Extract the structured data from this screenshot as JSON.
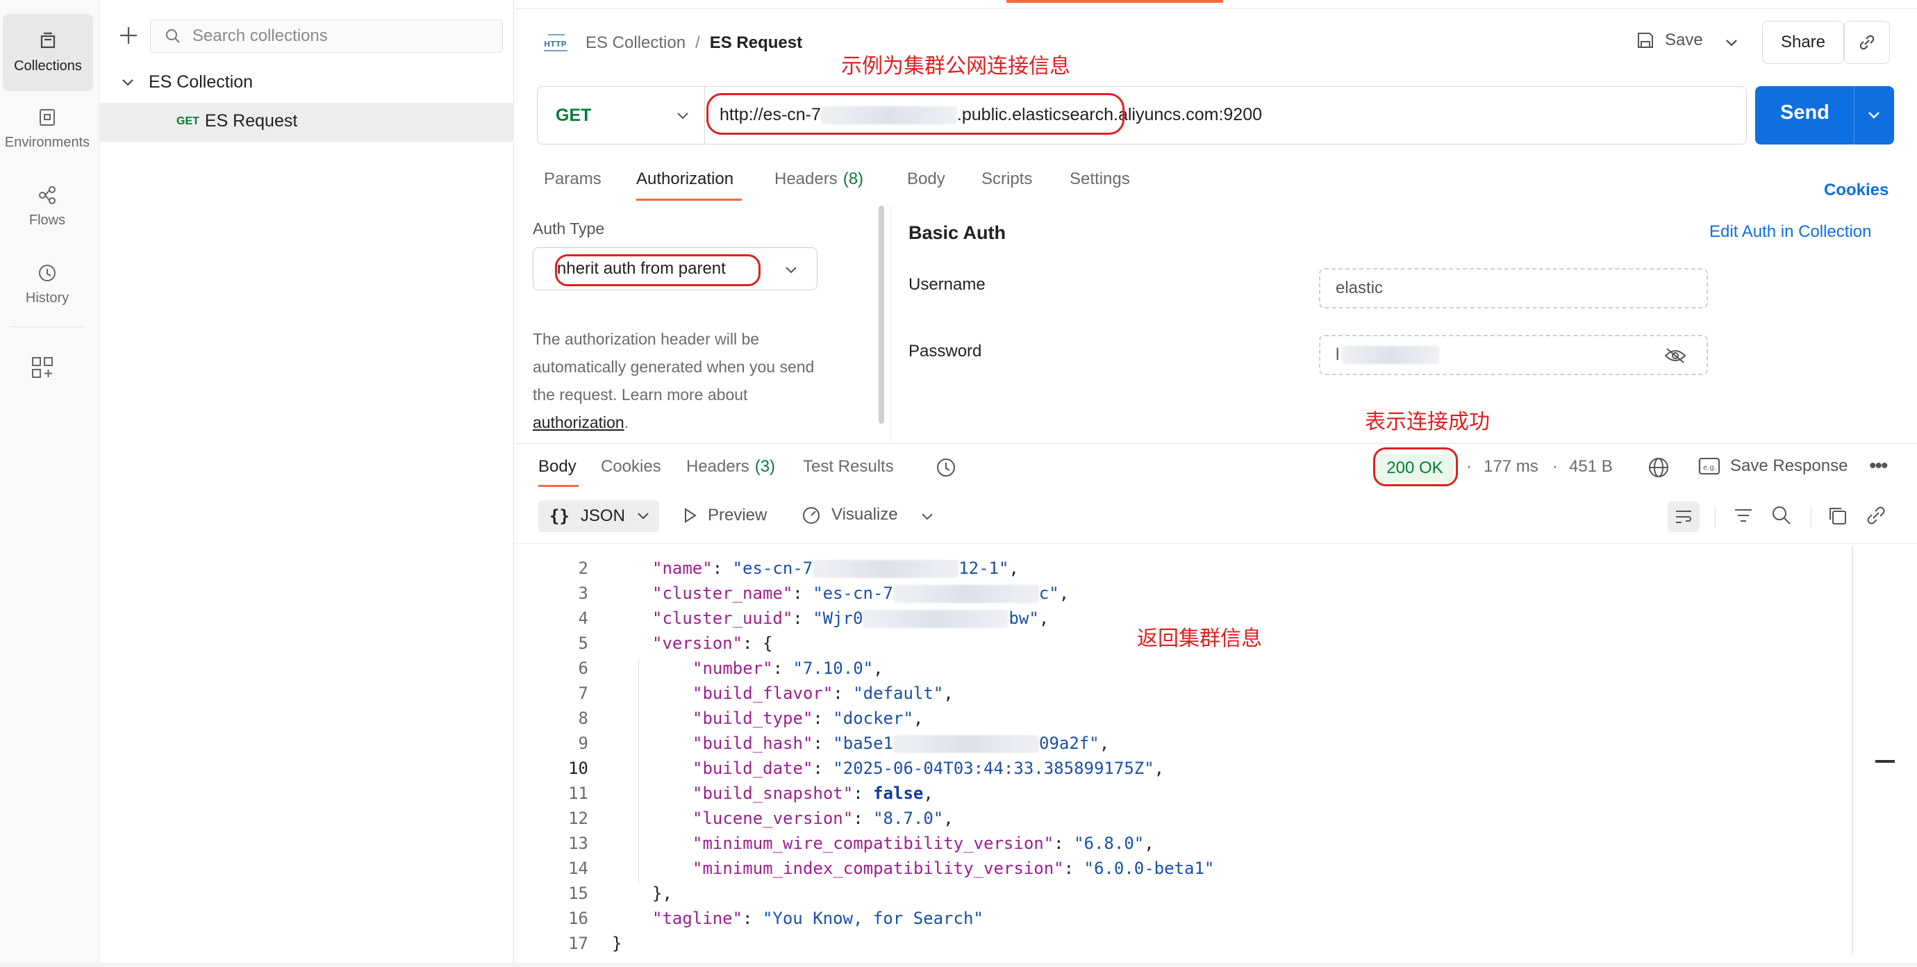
{
  "rail": {
    "items": [
      {
        "label": "Collections",
        "icon": "collections-icon"
      },
      {
        "label": "Environments",
        "icon": "environments-icon"
      },
      {
        "label": "Flows",
        "icon": "flows-icon"
      },
      {
        "label": "History",
        "icon": "history-icon"
      }
    ]
  },
  "sidebar": {
    "search_placeholder": "Search collections",
    "collection_name": "ES Collection",
    "request_method": "GET",
    "request_name": "ES Request"
  },
  "header": {
    "breadcrumb_parent": "ES Collection",
    "breadcrumb_sep": "/",
    "breadcrumb_current": "ES Request",
    "save_label": "Save",
    "share_label": "Share"
  },
  "request": {
    "method": "GET",
    "url_prefix": "http://es-cn-7",
    "url_suffix": ".public.elasticsearch.aliyuncs.com:9200",
    "send_label": "Send"
  },
  "req_tabs": {
    "params": "Params",
    "authorization": "Authorization",
    "headers": "Headers",
    "headers_count": "(8)",
    "body": "Body",
    "scripts": "Scripts",
    "settings": "Settings",
    "cookies": "Cookies"
  },
  "auth": {
    "type_label": "Auth Type",
    "type_value": "nherit auth from parent",
    "help_line1": "The authorization header will be",
    "help_line2": "automatically generated when you send",
    "help_line3": "the request. Learn more about",
    "help_link": "authorization",
    "help_end": ".",
    "basic_title": "Basic Auth",
    "edit_link": "Edit Auth in Collection",
    "username_label": "Username",
    "username_value": "elastic",
    "password_label": "Password",
    "password_value": "l"
  },
  "annotations": {
    "url_note": "示例为集群公网连接信息",
    "status_note": "表示连接成功",
    "body_note": "返回集群信息"
  },
  "response": {
    "tabs": {
      "body": "Body",
      "cookies": "Cookies",
      "headers": "Headers",
      "headers_count": "(3)",
      "test_results": "Test Results"
    },
    "status": "200 OK",
    "time": "177 ms",
    "size": "451 B",
    "save_response": "Save Response",
    "format": "JSON",
    "preview": "Preview",
    "visualize": "Visualize",
    "lines": [
      {
        "n": "2",
        "key": "\"name\"",
        "val": "\"es-cn-7",
        "val_end": "12-1\"",
        "blur": true,
        "indent": 1,
        "end": ","
      },
      {
        "n": "3",
        "key": "\"cluster_name\"",
        "val": "\"es-cn-7",
        "val_end": "c\"",
        "blur": true,
        "indent": 1,
        "end": ","
      },
      {
        "n": "4",
        "key": "\"cluster_uuid\"",
        "val": "\"Wjr0",
        "val_end": "bw\"",
        "blur": true,
        "indent": 1,
        "end": ","
      },
      {
        "n": "5",
        "key": "\"version\"",
        "val": "{",
        "indent": 1,
        "end": "",
        "plain": true
      },
      {
        "n": "6",
        "key": "\"number\"",
        "val": "\"7.10.0\"",
        "indent": 2,
        "end": ","
      },
      {
        "n": "7",
        "key": "\"build_flavor\"",
        "val": "\"default\"",
        "indent": 2,
        "end": ","
      },
      {
        "n": "8",
        "key": "\"build_type\"",
        "val": "\"docker\"",
        "indent": 2,
        "end": ","
      },
      {
        "n": "9",
        "key": "\"build_hash\"",
        "val": "\"ba5e1",
        "val_end": "09a2f\"",
        "blur": true,
        "indent": 2,
        "end": ","
      },
      {
        "n": "10",
        "key": "\"build_date\"",
        "val": "\"2025-06-04T03:44:33.385899175Z\"",
        "indent": 2,
        "end": ","
      },
      {
        "n": "11",
        "key": "\"build_snapshot\"",
        "val": "false",
        "indent": 2,
        "end": ",",
        "kw": true
      },
      {
        "n": "12",
        "key": "\"lucene_version\"",
        "val": "\"8.7.0\"",
        "indent": 2,
        "end": ","
      },
      {
        "n": "13",
        "key": "\"minimum_wire_compatibility_version\"",
        "val": "\"6.8.0\"",
        "indent": 2,
        "end": ","
      },
      {
        "n": "14",
        "key": "\"minimum_index_compatibility_version\"",
        "val": "\"6.0.0-beta1\"",
        "indent": 2,
        "end": ""
      },
      {
        "n": "15",
        "raw": "},",
        "indent": 1
      },
      {
        "n": "16",
        "key": "\"tagline\"",
        "val": "\"You Know, for Search\"",
        "indent": 1,
        "end": ""
      },
      {
        "n": "17",
        "raw": "}",
        "indent": 0
      }
    ]
  }
}
